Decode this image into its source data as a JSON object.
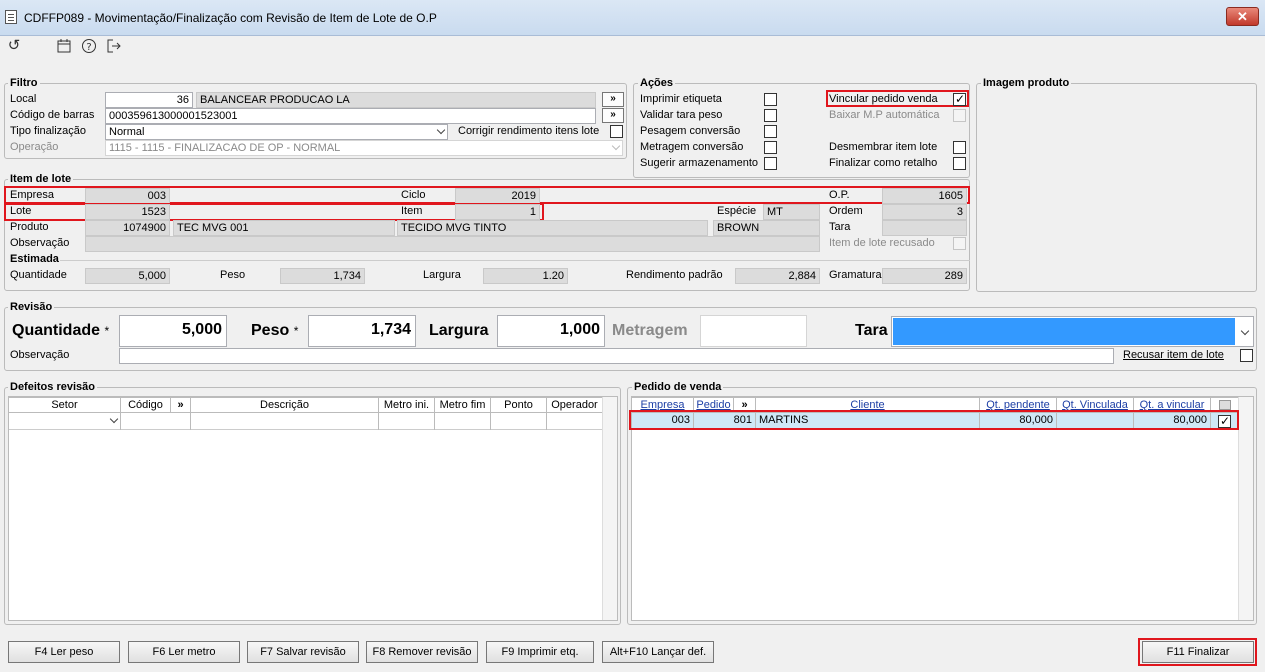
{
  "window": {
    "title": "CDFFP089 - Movimentação/Finalização com Revisão de Item de Lote de O.P",
    "close": "✕"
  },
  "toolbar": {
    "refresh_icon": "↺",
    "calendar_icon": "calendar-icon",
    "help_icon": "?",
    "exit_icon": "exit-icon"
  },
  "filtro": {
    "title": "Filtro",
    "local_label": "Local",
    "local_code": "36",
    "local_name": "BALANCEAR PRODUCAO LA",
    "barcode_label": "Código de barras",
    "barcode_value": "000359613000001523001",
    "tipo_label": "Tipo finalização",
    "tipo_value": "Normal",
    "corrigir_label": "Corrigir rendimento itens lote",
    "operacao_label": "Operação",
    "operacao_value": "1115 - 1115 - FINALIZACAO DE OP - NORMAL",
    "nav_btn": "»"
  },
  "acoes": {
    "title": "Ações",
    "left": [
      "Imprimir etiqueta",
      "Validar tara peso",
      "Pesagem conversão",
      "Metragem conversão",
      "Sugerir armazenamento"
    ],
    "vincular": "Vincular pedido venda",
    "baixar": "Baixar M.P automática",
    "desmembrar": "Desmembrar item lote",
    "finalizar_retalho": "Finalizar como retalho"
  },
  "imagem": {
    "title": "Imagem produto"
  },
  "item": {
    "title": "Item de lote",
    "empresa_label": "Empresa",
    "empresa": "003",
    "ciclo_label": "Ciclo",
    "ciclo": "2019",
    "op_label": "O.P.",
    "op": "1605",
    "lote_label": "Lote",
    "lote": "1523",
    "item_label": "Item",
    "item": "1",
    "especie_label": "Espécie",
    "especie": "MT",
    "ordem_label": "Ordem",
    "ordem": "3",
    "produto_label": "Produto",
    "produto_code": "1074900",
    "produto_name": "TEC MVG 001",
    "produto_desc": "TECIDO MVG TINTO",
    "cor": "BROWN",
    "tara_label": "Tara",
    "obs_label": "Observação",
    "recusado_label": "Item de lote recusado"
  },
  "estimada": {
    "title": "Estimada",
    "quantidade_label": "Quantidade",
    "quantidade": "5,000",
    "peso_label": "Peso",
    "peso": "1,734",
    "largura_label": "Largura",
    "largura": "1.20",
    "rend_label": "Rendimento padrão",
    "rend": "2,884",
    "gramatura_label": "Gramatura",
    "gramatura": "289"
  },
  "revisao": {
    "title": "Revisão",
    "quantidade_label": "Quantidade",
    "quantidade": "5,000",
    "peso_label": "Peso",
    "peso": "1,734",
    "largura_label": "Largura",
    "largura": "1,000",
    "metragem_label": "Metragem",
    "metragem": "",
    "tara_label": "Tara",
    "obs_label": "Observação",
    "recusar_label": "Recusar item de lote",
    "required": "*"
  },
  "defeitos": {
    "title": "Defeitos revisão",
    "columns": [
      "Setor",
      "Código",
      "»",
      "Descrição",
      "Metro ini.",
      "Metro fim",
      "Ponto",
      "Operador"
    ]
  },
  "pedido": {
    "title": "Pedido de venda",
    "columns": [
      "Empresa",
      "Pedido",
      "»",
      "Cliente",
      "Qt. pendente",
      "Qt. Vinculada",
      "Qt. a vincular"
    ],
    "rows": [
      {
        "empresa": "003",
        "pedido": "801",
        "cliente": "MARTINS",
        "pendente": "80,000",
        "vinculada": "",
        "vincular": "80,000",
        "checked": true
      }
    ]
  },
  "footer": {
    "buttons": [
      "F4 Ler peso",
      "F6 Ler metro",
      "F7 Salvar revisão",
      "F8 Remover revisão",
      "F9 Imprimir etq.",
      "Alt+F10 Lançar def."
    ],
    "finalizar": "F11 Finalizar"
  },
  "colors": {
    "highlight": "#e0161d",
    "tara_fill": "#3399ff",
    "row_bg": "#cfe8f6"
  }
}
